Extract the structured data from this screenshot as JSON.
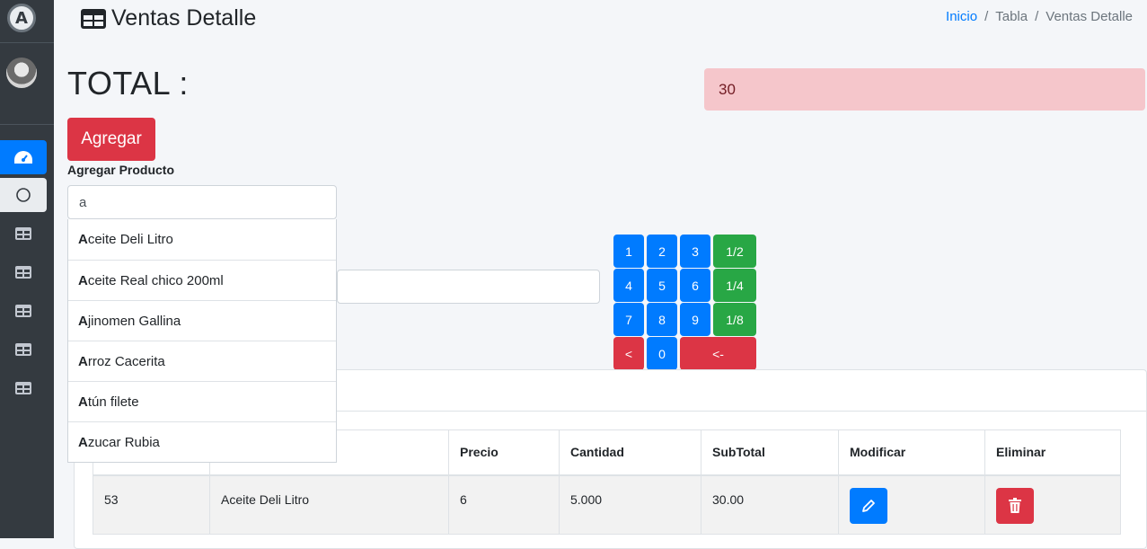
{
  "header": {
    "title": "Ventas Detalle",
    "breadcrumb": [
      {
        "label": "Inicio",
        "link": true
      },
      {
        "sep": "/"
      },
      {
        "label": "Tabla",
        "link": false
      },
      {
        "sep": "/"
      },
      {
        "label": "Ventas Detalle",
        "link": false
      }
    ]
  },
  "sidebar": {
    "items": [
      {
        "icon": "tachometer-icon",
        "active": true
      },
      {
        "icon": "circle-icon",
        "active": false
      },
      {
        "icon": "table-icon",
        "active": false
      },
      {
        "icon": "table-icon",
        "active": false
      },
      {
        "icon": "table-icon",
        "active": false
      },
      {
        "icon": "table-icon",
        "active": false
      },
      {
        "icon": "table-icon",
        "active": false
      }
    ]
  },
  "total": {
    "label": "TOTAL :",
    "value": "30"
  },
  "form": {
    "add_button": "Agregar",
    "product_label": "Agregar Producto",
    "search_value": "a"
  },
  "suggestions": [
    {
      "match": "A",
      "rest": "ceite Deli Litro"
    },
    {
      "match": "A",
      "rest": "ceite Real chico 200ml"
    },
    {
      "match": "A",
      "rest": "jinomen Gallina"
    },
    {
      "match": "A",
      "rest": "rroz Cacerita"
    },
    {
      "match": "A",
      "rest": "tún filete"
    },
    {
      "match": "A",
      "rest": "zucar Rubia"
    }
  ],
  "keypad": {
    "k1": "1",
    "k2": "2",
    "k3": "3",
    "half": "1/2",
    "k4": "4",
    "k5": "5",
    "k6": "6",
    "quarter": "1/4",
    "k7": "7",
    "k8": "8",
    "k9": "9",
    "eighth": "1/8",
    "lt": "<",
    "k0": "0",
    "back": "<-"
  },
  "table": {
    "columns": [
      "",
      "",
      "Precio",
      "Cantidad",
      "SubTotal",
      "Modificar",
      "Eliminar"
    ],
    "rows": [
      {
        "id": "53",
        "product": "Aceite Deli Litro",
        "price": "6",
        "qty": "5.000",
        "subtotal": "30.00"
      }
    ]
  },
  "colors": {
    "primary": "#007bff",
    "danger": "#dc3545",
    "success": "#28a745",
    "sidebar": "#343a40",
    "total_bg": "#f5c6cb"
  }
}
